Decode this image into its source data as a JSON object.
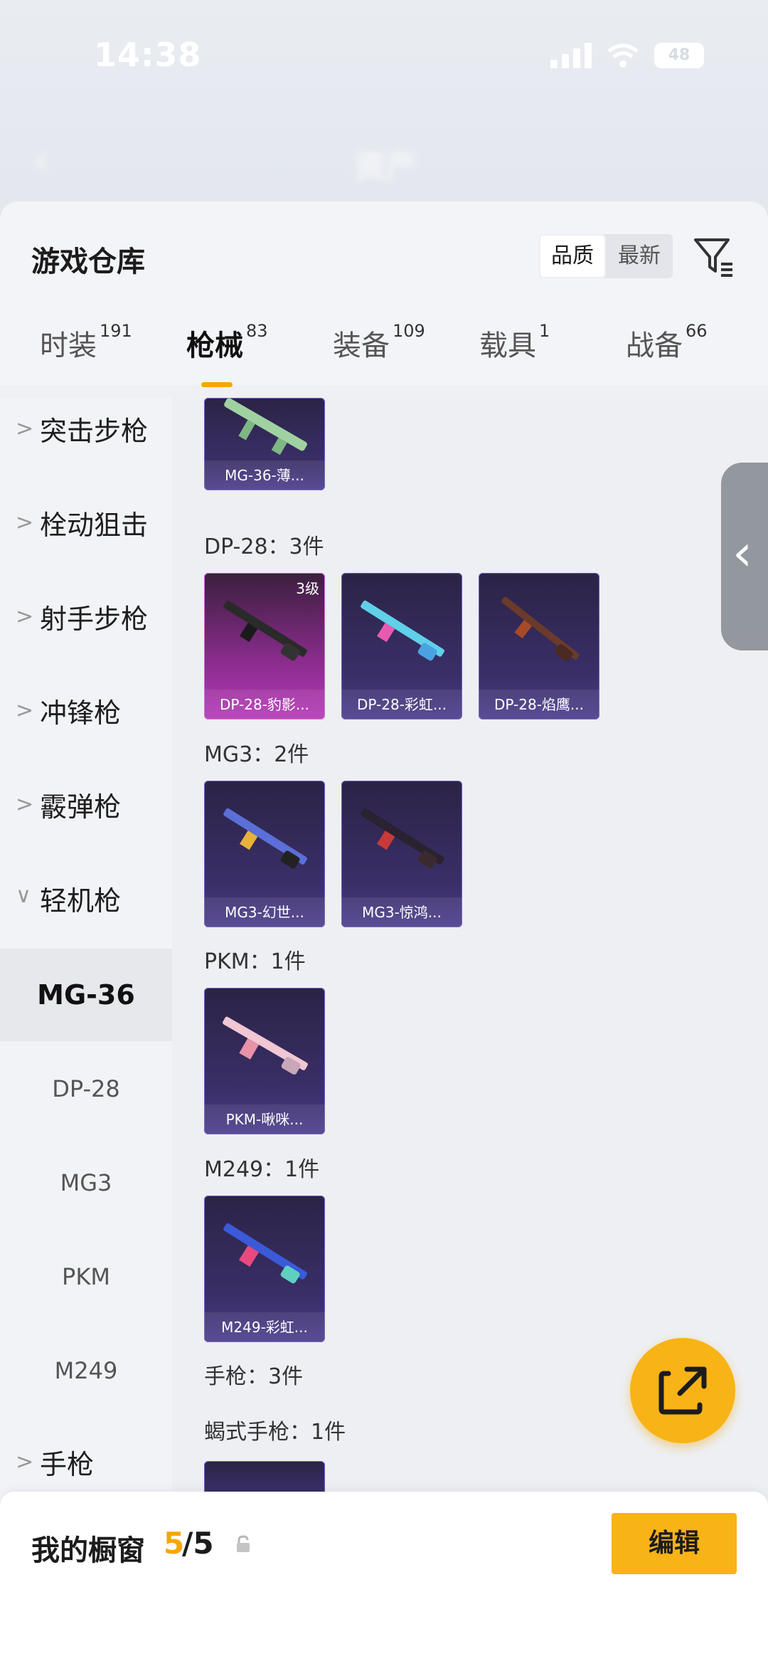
{
  "status_bar": {
    "time": "14:38",
    "battery": "48"
  },
  "background_header": {
    "title": "资产",
    "subtitle": ""
  },
  "panel": {
    "title": "游戏仓库",
    "sort": {
      "quality": "品质",
      "latest": "最新",
      "active": "quality"
    }
  },
  "tabs": [
    {
      "label": "时装",
      "count": "191"
    },
    {
      "label": "枪械",
      "count": "83",
      "active": true
    },
    {
      "label": "装备",
      "count": "109"
    },
    {
      "label": "载具",
      "count": "1"
    },
    {
      "label": "战备",
      "count": "66"
    }
  ],
  "sidebar": {
    "categories": [
      {
        "label": "突击步枪",
        "chevron": "right"
      },
      {
        "label": "栓动狙击",
        "chevron": "right"
      },
      {
        "label": "射手步枪",
        "chevron": "right"
      },
      {
        "label": "冲锋枪",
        "chevron": "right"
      },
      {
        "label": "霰弹枪",
        "chevron": "right"
      },
      {
        "label": "轻机枪",
        "chevron": "down"
      }
    ],
    "subcategories": [
      {
        "label": "MG-36",
        "active": true
      },
      {
        "label": "DP-28"
      },
      {
        "label": "MG3"
      },
      {
        "label": "PKM"
      },
      {
        "label": "M249"
      }
    ],
    "last_category": {
      "label": "手枪",
      "chevron": "right"
    }
  },
  "groups": [
    {
      "label": "DP-28：3件",
      "items": [
        {
          "name": "DP-28-豹影...",
          "level": "3级",
          "rarity": "pink"
        },
        {
          "name": "DP-28-彩虹..."
        },
        {
          "name": "DP-28-焰鹰..."
        }
      ]
    },
    {
      "label": "MG3：2件",
      "items": [
        {
          "name": "MG3-幻世..."
        },
        {
          "name": "MG3-惊鸿..."
        }
      ]
    },
    {
      "label": "PKM：1件",
      "items": [
        {
          "name": "PKM-啾咪..."
        }
      ]
    },
    {
      "label": "M249：1件",
      "items": [
        {
          "name": "M249-彩虹..."
        }
      ]
    },
    {
      "label": "手枪：3件",
      "items": []
    },
    {
      "label": "蝎式手枪：1件",
      "items": []
    }
  ],
  "top_partial_item": {
    "name": "MG-36-薄..."
  },
  "side_handle": {
    "icon": "chevron-left-icon"
  },
  "fab": {
    "icon": "share-icon"
  },
  "bottom": {
    "label": "我的橱窗",
    "count_current": "5",
    "count_rest": "/5",
    "lock_icon": "lock-icon",
    "edit": "编辑"
  },
  "colors": {
    "accent": "#f5a700",
    "fab": "#f8b316",
    "card": "#3a2f68",
    "card_pink": "#b53ab8"
  }
}
